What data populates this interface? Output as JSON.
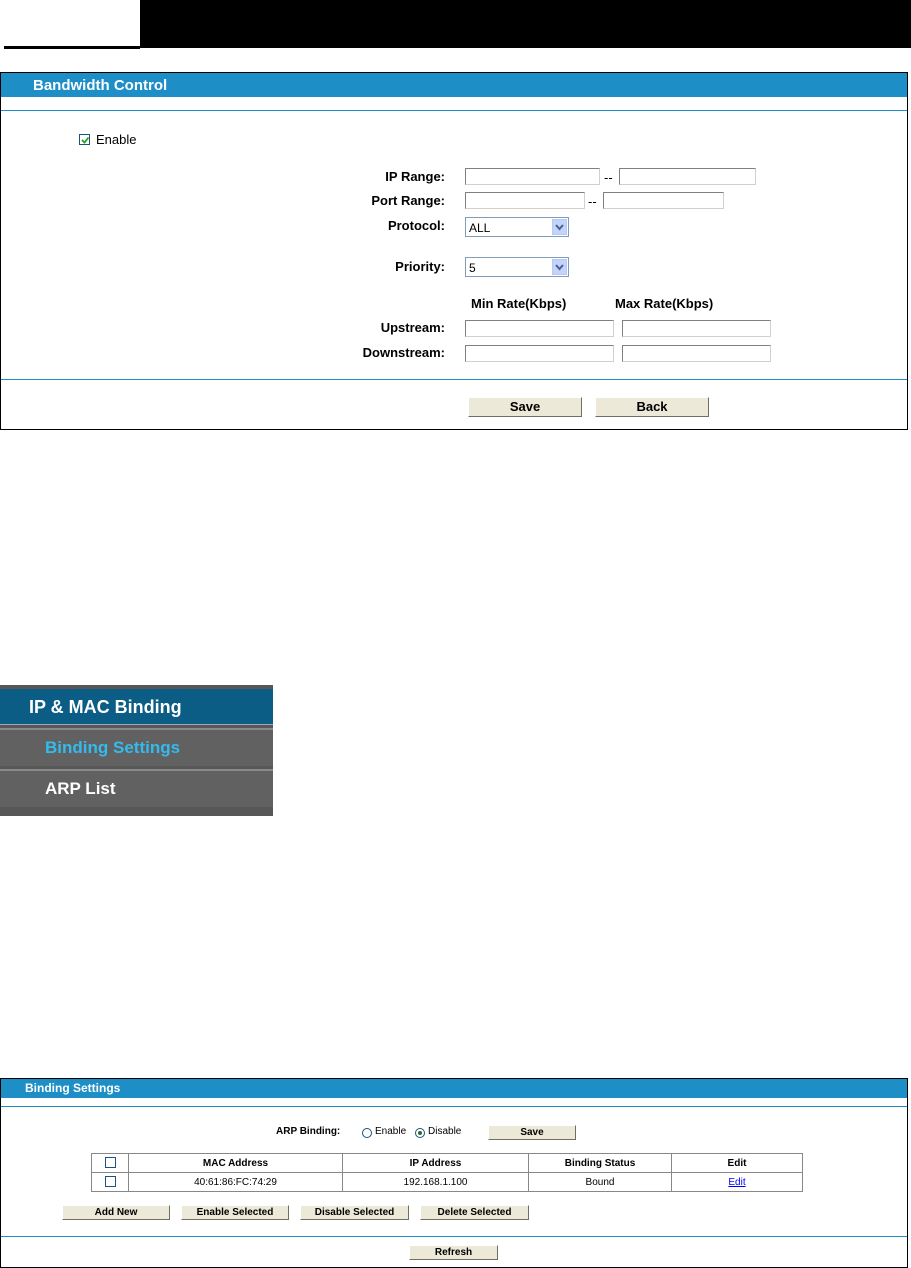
{
  "bandwidth": {
    "title": "Bandwidth Control",
    "enable_label": "Enable",
    "enable_checked": true,
    "ip_range_label": "IP Range:",
    "port_range_label": "Port Range:",
    "range_sep": "--",
    "protocol_label": "Protocol:",
    "protocol_value": "ALL",
    "priority_label": "Priority:",
    "priority_value": "5",
    "min_rate_header": "Min Rate(Kbps)",
    "max_rate_header": "Max Rate(Kbps)",
    "upstream_label": "Upstream:",
    "downstream_label": "Downstream:",
    "save_label": "Save",
    "back_label": "Back"
  },
  "menu": {
    "header": "IP & MAC Binding",
    "items": [
      {
        "label": "Binding Settings",
        "color": "#33bbee"
      },
      {
        "label": "ARP List",
        "color": "#ffffff"
      }
    ]
  },
  "binding": {
    "title": "Binding Settings",
    "arp_label": "ARP Binding:",
    "enable_label": "Enable",
    "disable_label": "Disable",
    "selected": "Disable",
    "save_label": "Save",
    "columns": [
      "MAC Address",
      "IP Address",
      "Binding Status",
      "Edit"
    ],
    "rows": [
      {
        "mac": "40:61:86:FC:74:29",
        "ip": "192.168.1.100",
        "status": "Bound",
        "edit": "Edit"
      }
    ],
    "buttons": [
      "Add New",
      "Enable Selected",
      "Disable Selected",
      "Delete Selected"
    ],
    "refresh_label": "Refresh"
  },
  "colors": {
    "accent": "#1d8fc6",
    "menu_header": "#0c5d86",
    "menu_bg": "#616161"
  }
}
